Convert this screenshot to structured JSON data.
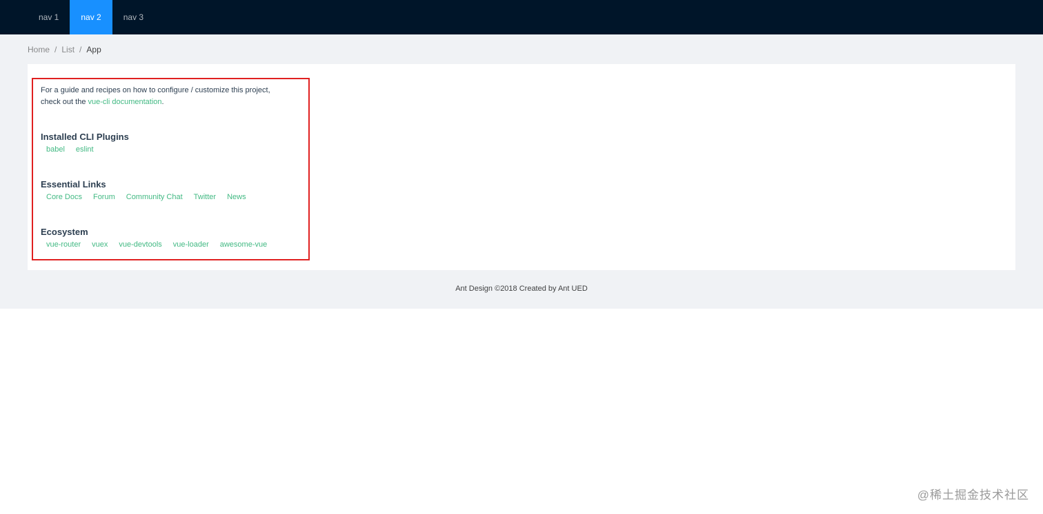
{
  "header": {
    "nav": [
      {
        "label": "nav 1",
        "active": false
      },
      {
        "label": "nav 2",
        "active": true
      },
      {
        "label": "nav 3",
        "active": false
      }
    ]
  },
  "breadcrumb": {
    "items": [
      "Home",
      "List",
      "App"
    ],
    "separator": "/"
  },
  "hello": {
    "intro_line1": "For a guide and recipes on how to configure / customize this project,",
    "intro_prefix": "check out the ",
    "intro_link": "vue-cli documentation",
    "intro_suffix": ".",
    "sections": [
      {
        "title": "Installed CLI Plugins",
        "links": [
          "babel",
          "eslint"
        ]
      },
      {
        "title": "Essential Links",
        "links": [
          "Core Docs",
          "Forum",
          "Community Chat",
          "Twitter",
          "News"
        ]
      },
      {
        "title": "Ecosystem",
        "links": [
          "vue-router",
          "vuex",
          "vue-devtools",
          "vue-loader",
          "awesome-vue"
        ]
      }
    ]
  },
  "footer": {
    "text": "Ant Design ©2018 Created by Ant UED"
  },
  "watermark": "@稀土掘金技术社区",
  "colors": {
    "header_bg": "#001529",
    "nav_active_bg": "#1890ff",
    "layout_bg": "#f0f2f5",
    "link_green": "#42b983",
    "highlight_border": "#e02020"
  }
}
